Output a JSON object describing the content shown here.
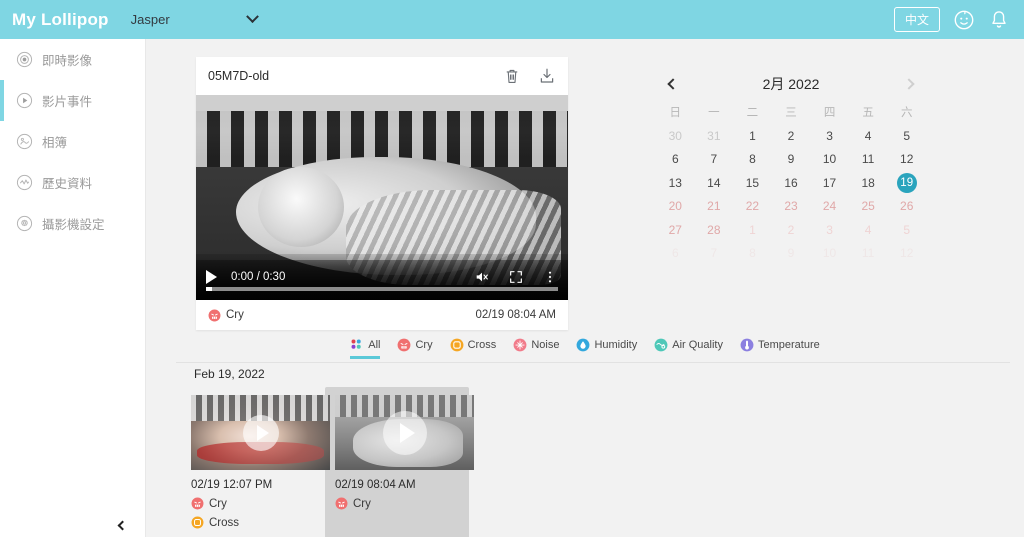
{
  "header": {
    "brand": "My Lollipop",
    "child_name": "Jasper",
    "dropdown_icon": "chevron-down-icon",
    "lang_button": "中文",
    "baby_icon": "baby-face-icon",
    "bell_icon": "bell-icon",
    "bg_color": "#7fd6e3"
  },
  "sidebar": {
    "items": [
      {
        "label": "即時影像",
        "icon": "live-video-icon",
        "active": false
      },
      {
        "label": "影片事件",
        "icon": "play-circle-icon",
        "active": true
      },
      {
        "label": "相簿",
        "icon": "album-icon",
        "active": false
      },
      {
        "label": "歷史資料",
        "icon": "history-chart-icon",
        "active": false
      },
      {
        "label": "攝影機設定",
        "icon": "gear-icon",
        "active": false
      }
    ],
    "collapse_icon": "chevron-left-icon",
    "active_color": "#7fd6e3"
  },
  "video": {
    "title": "05M7D-old",
    "delete_icon": "trash-icon",
    "download_icon": "download-icon",
    "play_icon": "play-icon",
    "time_display": "0:00 / 0:30",
    "current_time": "0:00",
    "duration": "0:30",
    "mute_icon": "volume-muted-icon",
    "fullscreen_icon": "fullscreen-icon",
    "more_icon": "more-vertical-icon",
    "progress_percent": 0,
    "event_label": "Cry",
    "event_icon": "cry-face-icon",
    "event_time": "02/19 08:04 AM"
  },
  "calendar": {
    "title": "2月 2022",
    "prev_icon": "chevron-left-icon",
    "next_icon": "chevron-right-icon",
    "dow": [
      "日",
      "一",
      "二",
      "三",
      "四",
      "五",
      "六"
    ],
    "selected_day": 19,
    "selected_color": "#2aa4bd",
    "weeks": [
      [
        {
          "d": "30",
          "state": "muted"
        },
        {
          "d": "31",
          "state": "muted"
        },
        {
          "d": "1",
          "state": "normal"
        },
        {
          "d": "2",
          "state": "normal"
        },
        {
          "d": "3",
          "state": "normal"
        },
        {
          "d": "4",
          "state": "normal"
        },
        {
          "d": "5",
          "state": "normal"
        }
      ],
      [
        {
          "d": "6",
          "state": "normal"
        },
        {
          "d": "7",
          "state": "normal"
        },
        {
          "d": "8",
          "state": "normal"
        },
        {
          "d": "9",
          "state": "normal"
        },
        {
          "d": "10",
          "state": "normal"
        },
        {
          "d": "11",
          "state": "normal"
        },
        {
          "d": "12",
          "state": "normal"
        }
      ],
      [
        {
          "d": "13",
          "state": "normal"
        },
        {
          "d": "14",
          "state": "normal"
        },
        {
          "d": "15",
          "state": "normal"
        },
        {
          "d": "16",
          "state": "normal"
        },
        {
          "d": "17",
          "state": "normal"
        },
        {
          "d": "18",
          "state": "normal"
        },
        {
          "d": "19",
          "state": "selected"
        }
      ],
      [
        {
          "d": "20",
          "state": "pink"
        },
        {
          "d": "21",
          "state": "pink"
        },
        {
          "d": "22",
          "state": "pink"
        },
        {
          "d": "23",
          "state": "pink"
        },
        {
          "d": "24",
          "state": "pink"
        },
        {
          "d": "25",
          "state": "pink"
        },
        {
          "d": "26",
          "state": "pink"
        }
      ],
      [
        {
          "d": "27",
          "state": "pink"
        },
        {
          "d": "28",
          "state": "pink"
        },
        {
          "d": "1",
          "state": "pink-dim"
        },
        {
          "d": "2",
          "state": "pink-dim"
        },
        {
          "d": "3",
          "state": "pink-dim"
        },
        {
          "d": "4",
          "state": "pink-dim"
        },
        {
          "d": "5",
          "state": "pink-dim"
        }
      ],
      [
        {
          "d": "6",
          "state": "faint"
        },
        {
          "d": "7",
          "state": "faint"
        },
        {
          "d": "8",
          "state": "faint"
        },
        {
          "d": "9",
          "state": "faint"
        },
        {
          "d": "10",
          "state": "faint"
        },
        {
          "d": "11",
          "state": "faint"
        },
        {
          "d": "12",
          "state": "faint"
        }
      ]
    ]
  },
  "filters": [
    {
      "label": "All",
      "icon": "dots-multicolor-icon",
      "active": true,
      "color": "#d94a5a"
    },
    {
      "label": "Cry",
      "icon": "cry-face-icon",
      "active": false,
      "color": "#f07070"
    },
    {
      "label": "Cross",
      "icon": "cross-face-icon",
      "active": false,
      "color": "#f5a623"
    },
    {
      "label": "Noise",
      "icon": "noise-icon",
      "active": false,
      "color": "#f17b8a"
    },
    {
      "label": "Humidity",
      "icon": "water-drop-icon",
      "active": false,
      "color": "#33a8dd"
    },
    {
      "label": "Air Quality",
      "icon": "air-quality-icon",
      "active": false,
      "color": "#4ec8b8"
    },
    {
      "label": "Temperature",
      "icon": "thermometer-icon",
      "active": false,
      "color": "#8b7fe0"
    }
  ],
  "events": {
    "day_label": "Feb 19, 2022",
    "cards": [
      {
        "time": "02/19 12:07 PM",
        "selected": false,
        "play_icon": "play-overlay-icon",
        "tags": [
          {
            "label": "Cry",
            "icon": "cry-face-icon",
            "color": "#f07070"
          },
          {
            "label": "Cross",
            "icon": "cross-face-icon",
            "color": "#f5a623"
          }
        ]
      },
      {
        "time": "02/19 08:04 AM",
        "selected": true,
        "play_icon": "play-overlay-icon",
        "tags": [
          {
            "label": "Cry",
            "icon": "cry-face-icon",
            "color": "#f07070"
          }
        ]
      }
    ]
  }
}
